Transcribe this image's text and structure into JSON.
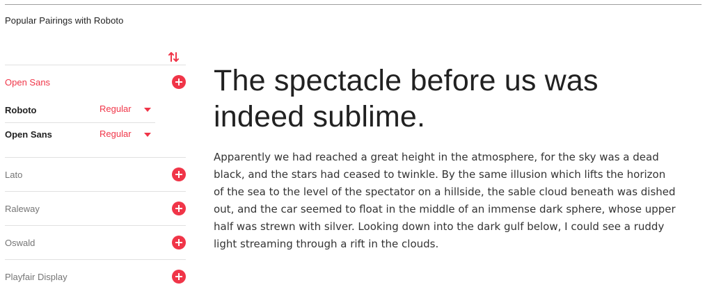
{
  "section": {
    "title": "Popular Pairings with Roboto"
  },
  "sidebar": {
    "active_pairing": {
      "label": "Open Sans",
      "primary": {
        "name": "Roboto",
        "weight": "Regular"
      },
      "secondary": {
        "name": "Open Sans",
        "weight": "Regular"
      }
    },
    "fonts": [
      {
        "label": "Lato"
      },
      {
        "label": "Raleway"
      },
      {
        "label": "Oswald"
      },
      {
        "label": "Playfair Display"
      }
    ]
  },
  "preview": {
    "headline": "The spectacle before us was indeed sublime.",
    "body": "Apparently we had reached a great height in the atmosphere, for the sky was a dead black, and the stars had ceased to twinkle. By the same illusion which lifts the horizon of the sea to the level of the spectator on a hillside, the sable cloud beneath was dished out, and the car seemed to float in the middle of an immense dark sphere, whose upper half was strewn with silver. Looking down into the dark gulf below, I could see a ruddy light streaming through a rift in the clouds."
  },
  "colors": {
    "accent": "#f03548",
    "divider": "#e0e0e0",
    "text_muted": "#757575"
  },
  "icons": {
    "add": "plus-circle-icon",
    "swap": "swap-vertical-icon",
    "dropdown": "caret-down-icon"
  }
}
